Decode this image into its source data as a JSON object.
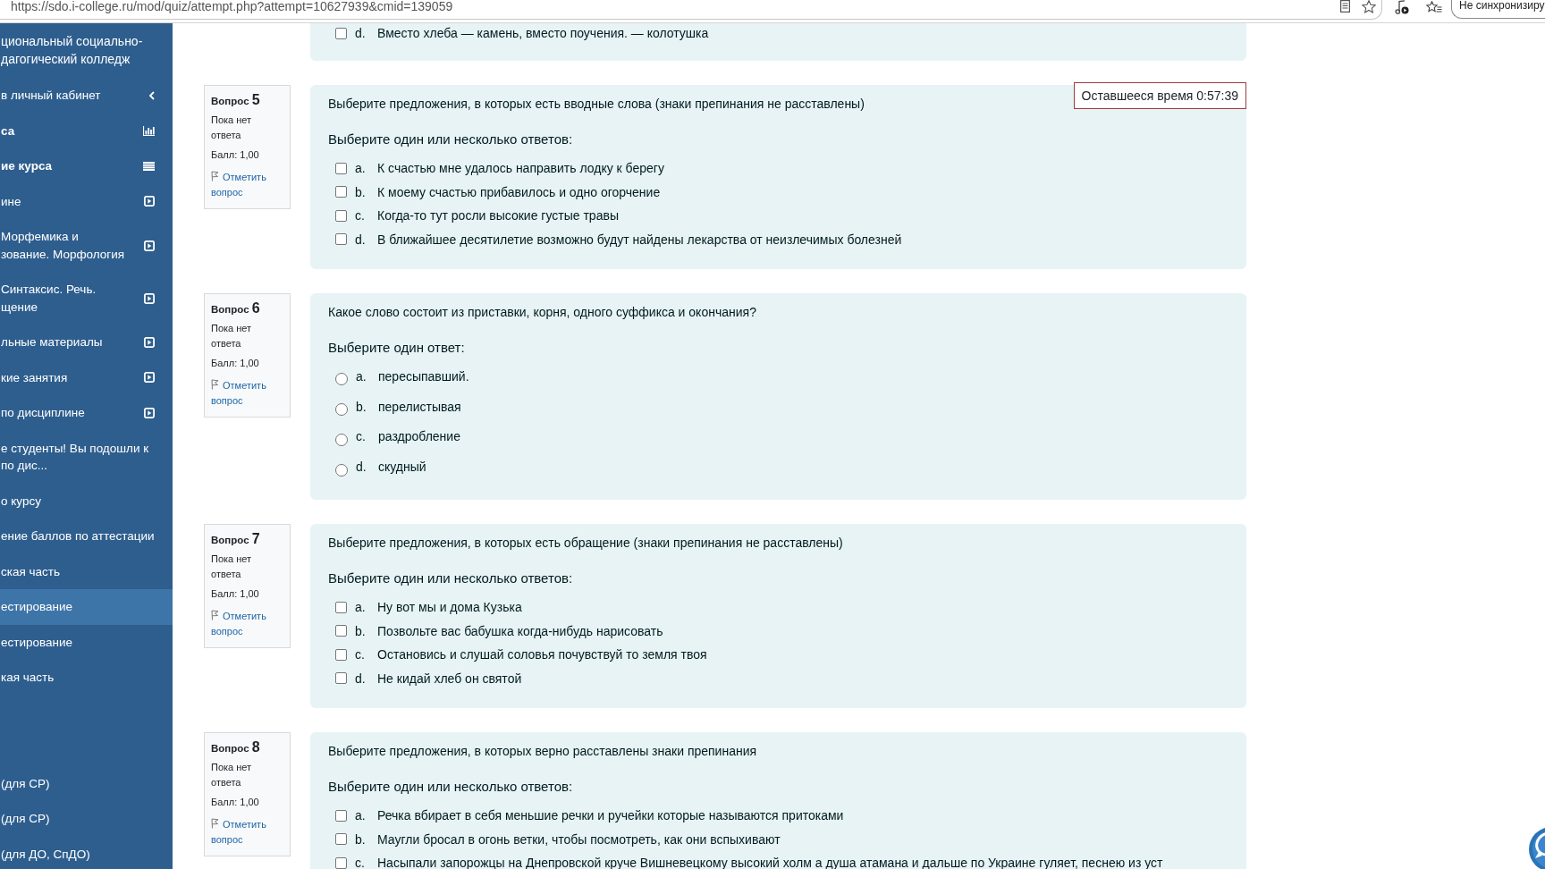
{
  "browser": {
    "url": "https://sdo.i-college.ru/mod/quiz/attempt.php?attempt=10627939&cmid=139059",
    "sync_button": "Не синхронизиру"
  },
  "sidebar": {
    "title_lines": [
      "циональный социально-",
      "дагогический колледж"
    ],
    "items": [
      {
        "kind": "back",
        "lines": [
          "в личный кабинет"
        ],
        "selected": false
      },
      {
        "kind": "grades",
        "lines": [
          "са"
        ],
        "selected": false
      },
      {
        "kind": "outline",
        "lines": [
          "ие курса"
        ],
        "selected": false
      },
      {
        "kind": "section",
        "lines": [
          "ине"
        ],
        "selected": false
      },
      {
        "kind": "section",
        "lines": [
          "Морфемика и",
          "зование. Морфология"
        ],
        "selected": false
      },
      {
        "kind": "section",
        "lines": [
          "Синтаксис. Речь.",
          "щение"
        ],
        "selected": false
      },
      {
        "kind": "section",
        "lines": [
          "льные материалы"
        ],
        "selected": false
      },
      {
        "kind": "section",
        "lines": [
          "кие занятия"
        ],
        "selected": false
      },
      {
        "kind": "section",
        "lines": [
          "по дисциплине"
        ],
        "selected": false
      },
      {
        "kind": "activity",
        "lines": [
          "е студенты! Вы подошли к",
          "по дис..."
        ],
        "selected": false
      },
      {
        "kind": "activity",
        "lines": [
          "о курсу"
        ],
        "selected": false
      },
      {
        "kind": "activity",
        "lines": [
          "ение баллов по аттестации"
        ],
        "selected": false
      },
      {
        "kind": "activity",
        "lines": [
          "ская часть"
        ],
        "selected": false
      },
      {
        "kind": "activity",
        "lines": [
          "естирование"
        ],
        "selected": true
      },
      {
        "kind": "activity",
        "lines": [
          "естирование"
        ],
        "selected": false
      },
      {
        "kind": "activity",
        "lines": [
          "кая часть"
        ],
        "selected": false
      }
    ],
    "footer_items": [
      {
        "lines": [
          "(для СР)"
        ],
        "selected": false
      },
      {
        "lines": [
          "(для СР)"
        ],
        "selected": false
      },
      {
        "lines": [
          "(для ДО, СпДО)"
        ],
        "selected": false
      }
    ]
  },
  "quiz_timer": {
    "text": "Оставшееся время 0:57:39"
  },
  "previous_question": {
    "kind": "checkbox",
    "options": [
      {
        "letter": "d.",
        "text": "Вместо хлеба — камень, вместо поучения. — колотушка",
        "checked": false
      }
    ]
  },
  "questions": [
    {
      "label": "Вопрос",
      "number": "5",
      "status": "Пока нет ответа",
      "score": "Балл: 1,00",
      "flag_link": "Отметить вопрос",
      "text": "Выберите предложения, в которых есть вводные слова (знаки препинания не расставлены)",
      "prompt": "Выберите один или несколько ответов:",
      "kind": "checkbox",
      "options": [
        {
          "letter": "a.",
          "text": "К счастью мне удалось направить лодку к берегу",
          "checked": false
        },
        {
          "letter": "b.",
          "text": "К моему счастью прибавилось и одно огорчение",
          "checked": false
        },
        {
          "letter": "c.",
          "text": "Когда-то тут росли высокие густые травы",
          "checked": false
        },
        {
          "letter": "d.",
          "text": "В ближайшее десятилетие возможно будут найдены лекарства от неизлечимых болезней",
          "checked": false
        }
      ]
    },
    {
      "label": "Вопрос",
      "number": "6",
      "status": "Пока нет ответа",
      "score": "Балл: 1,00",
      "flag_link": "Отметить вопрос",
      "text": "Какое слово состоит из приставки, корня, одного суффикса и окончания?",
      "prompt": "Выберите один ответ:",
      "kind": "radio",
      "options": [
        {
          "letter": "a.",
          "text": "пересыпавший.",
          "checked": false
        },
        {
          "letter": "b.",
          "text": "перелистывая",
          "checked": false
        },
        {
          "letter": "c.",
          "text": "раздробление",
          "checked": false
        },
        {
          "letter": "d.",
          "text": "скудный",
          "checked": false
        }
      ]
    },
    {
      "label": "Вопрос",
      "number": "7",
      "status": "Пока нет ответа",
      "score": "Балл: 1,00",
      "flag_link": "Отметить вопрос",
      "text": "Выберите предложения, в которых есть обращение (знаки препинания не расставлены)",
      "prompt": "Выберите один или несколько ответов:",
      "kind": "checkbox",
      "options": [
        {
          "letter": "a.",
          "text": "Ну вот мы и дома Кузька",
          "checked": false
        },
        {
          "letter": "b.",
          "text": "Позвольте вас бабушка когда-нибудь нарисовать",
          "checked": false
        },
        {
          "letter": "c.",
          "text": "Остановись и слушай соловья почувствуй то земля твоя",
          "checked": false
        },
        {
          "letter": "d.",
          "text": "Не кидай хлеб он святой",
          "checked": false
        }
      ]
    },
    {
      "label": "Вопрос",
      "number": "8",
      "status": "Пока нет ответа",
      "score": "Балл: 1,00",
      "flag_link": "Отметить вопрос",
      "text": "Выберите предложения, в которых верно расставлены знаки препинания",
      "prompt": "Выберите один или несколько ответов:",
      "kind": "checkbox",
      "options": [
        {
          "letter": "a.",
          "text": "Речка вбирает в себя меньшие речки и ручейки которые называются притоками",
          "checked": false
        },
        {
          "letter": "b.",
          "text": "Маугли бросал в огонь ветки, чтобы посмотреть, как они вспыхивают",
          "checked": false
        },
        {
          "letter": "c.",
          "text": "Насыпали запорожцы на Днепровской круче Вишневецкому высокий холм а душа атамана и дальше по Украине гуляет, песнею из уст",
          "checked": false
        }
      ]
    }
  ]
}
